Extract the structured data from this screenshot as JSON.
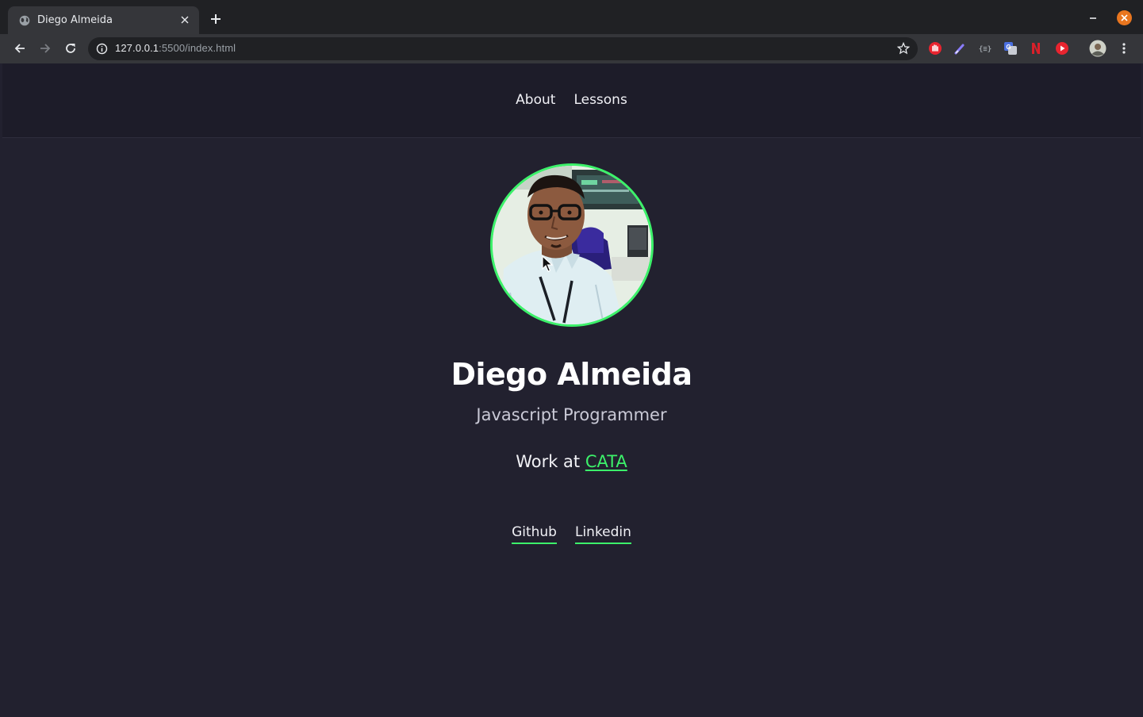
{
  "browser": {
    "tab_title": "Diego Almeida",
    "url_host": "127.0.0.1",
    "url_path": ":5500/index.html",
    "icons": {
      "favicon": "globe-icon",
      "tab_close": "close-icon",
      "new_tab": "plus-icon",
      "back": "arrow-left-icon",
      "forward": "arrow-right-icon",
      "reload": "reload-icon",
      "info": "info-icon",
      "bookmark": "star-icon",
      "menu": "kebab-menu-icon"
    },
    "extensions": [
      {
        "name": "stop-hand-extension-icon",
        "color": "#e8242f"
      },
      {
        "name": "color-picker-extension-icon",
        "color": "#6b8cff"
      },
      {
        "name": "json-formatter-extension-icon",
        "color": "#9aa0a6"
      },
      {
        "name": "google-translate-extension-icon",
        "color": "#4a6fe0"
      },
      {
        "name": "netflix-extension-icon",
        "color": "#d8202a"
      },
      {
        "name": "youtube-extension-icon",
        "color": "#e8242f"
      }
    ]
  },
  "nav": {
    "items": [
      "About",
      "Lessons"
    ]
  },
  "profile": {
    "name": "Diego Almeida",
    "role": "Javascript Programmer",
    "work_prefix": "Work at ",
    "work_company": "CATA"
  },
  "social": {
    "links": [
      "Github",
      "Linkedin"
    ]
  },
  "colors": {
    "accent": "#3cf16a",
    "page_bg": "#22212f",
    "header_bg": "#1d1c29"
  }
}
